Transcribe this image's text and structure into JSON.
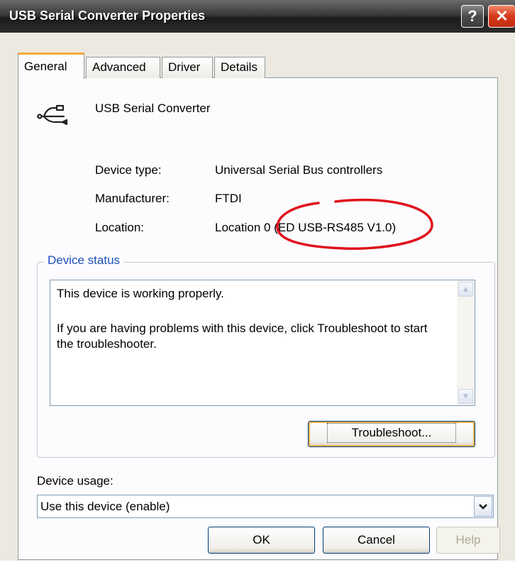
{
  "window": {
    "title": "USB Serial Converter Properties",
    "help_glyph": "?",
    "close_glyph": "✕"
  },
  "tabs": [
    {
      "label": "General",
      "active": true
    },
    {
      "label": "Advanced",
      "active": false
    },
    {
      "label": "Driver",
      "active": false
    },
    {
      "label": "Details",
      "active": false
    }
  ],
  "device": {
    "icon": "usb-icon",
    "name": "USB Serial Converter",
    "props": {
      "type_label": "Device type:",
      "type_value": "Universal Serial Bus controllers",
      "manufacturer_label": "Manufacturer:",
      "manufacturer_value": "FTDI",
      "location_label": "Location:",
      "location_value": "Location 0 (ED USB-RS485 V1.0)"
    }
  },
  "status": {
    "group_title": "Device status",
    "line1": "This device is working properly.",
    "line2": "If you are having problems with this device, click Troubleshoot to start the troubleshooter.",
    "troubleshoot_label": "Troubleshoot..."
  },
  "usage": {
    "label": "Device usage:",
    "value": "Use this device (enable)"
  },
  "buttons": {
    "ok": "OK",
    "cancel": "Cancel",
    "help": "Help"
  },
  "annotation_color": "#e0101c"
}
